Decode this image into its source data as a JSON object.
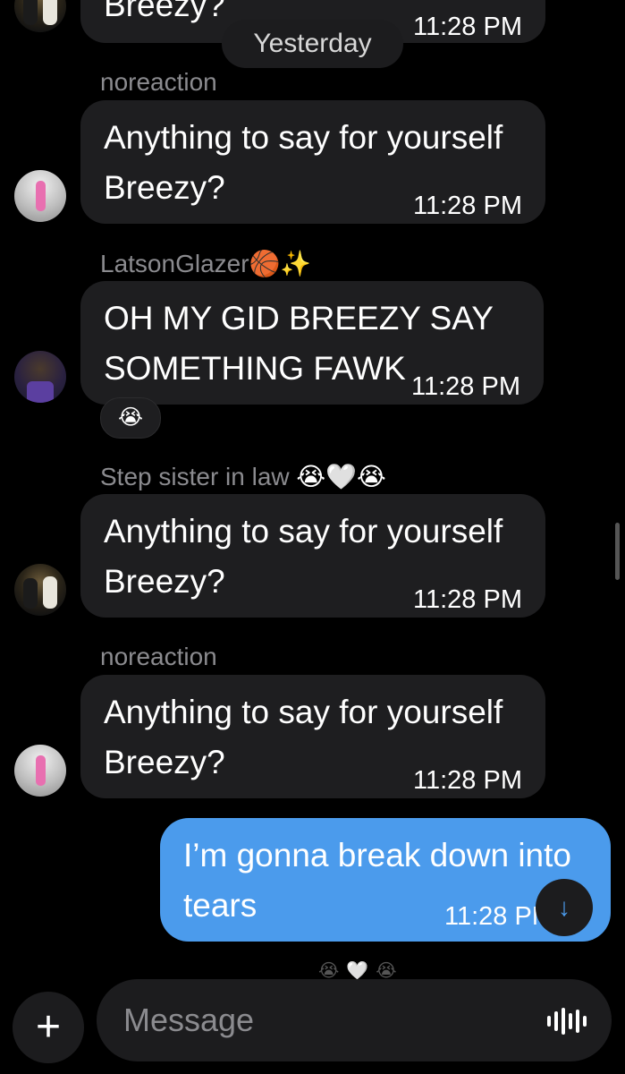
{
  "messages": [
    {
      "text": "Breezy?",
      "time": "11:28 PM"
    },
    {
      "sender": "noreaction",
      "text": "Anything to say for yourself\nBreezy?",
      "time": "11:28 PM"
    },
    {
      "sender": "LatsonGlazer",
      "sender_emoji": "🏀✨",
      "text": "OH MY GID BREEZY SAY\nSOMETHING FAWK",
      "time": "11:28 PM",
      "reaction": "😭"
    },
    {
      "sender": "Step sister in law",
      "sender_emoji": "😭🤍😭",
      "text": "Anything to say for yourself\nBreezy?",
      "time": "11:28 PM"
    },
    {
      "sender": "noreaction",
      "text": "Anything to say for yourself\nBreezy?",
      "time": "11:28 PM"
    }
  ],
  "date_divider": "Yesterday",
  "my_message": {
    "text": "I’m gonna break down into\ntears",
    "time": "11:28 PM"
  },
  "typing_indicator": "😭🤍😭",
  "composer": {
    "placeholder": "Message",
    "add_icon": "plus-icon",
    "voice_icon": "waveform-icon"
  },
  "scroll_down_icon": "arrow-down-icon",
  "colors": {
    "background": "#000000",
    "bubble": "#1e1e20",
    "my_bubble": "#4b9bec"
  }
}
